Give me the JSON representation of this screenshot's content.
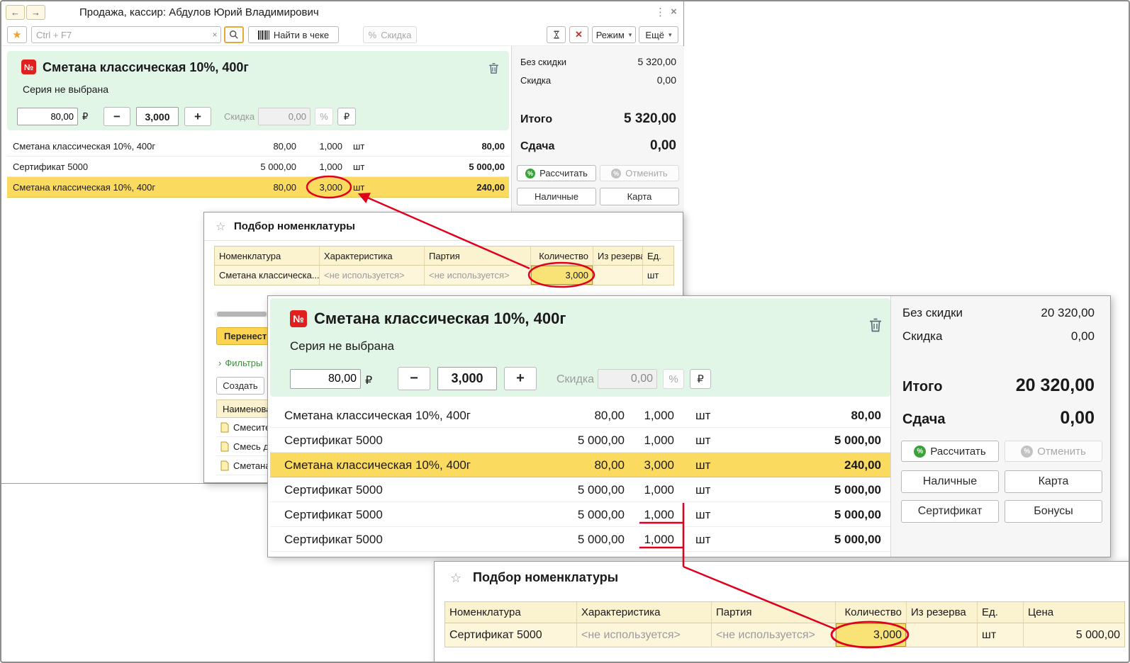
{
  "colors": {
    "accent_red": "#e0001e",
    "row_highlight": "#fbda60",
    "panel_green": "#e2f6e8",
    "header_yellow": "#fbf2d0"
  },
  "app": {
    "title": "Продажа, кассир: Абдулов Юрий Владимирович"
  },
  "icons": {
    "back": "←",
    "forward": "→",
    "menu": "⋮",
    "close": "×",
    "favorite": "★",
    "clear": "×",
    "cancel": "✕",
    "caret": "▾",
    "star_outline": "☆",
    "chevron": "›"
  },
  "sale1": {
    "toolbar": {
      "search_placeholder": "Ctrl + F7",
      "find_in_check": "Найти в чеке",
      "discount": "Скидка",
      "mode": "Режим",
      "more": "Ещё",
      "percent": "%"
    },
    "product": {
      "badge": "№",
      "name": "Сметана классическая 10%, 400г",
      "series": "Серия не выбрана",
      "price": "80,00",
      "currency": "₽",
      "minus": "−",
      "qty": "3,000",
      "plus": "+",
      "discount_label": "Скидка",
      "discount_value": "0,00",
      "percent": "%",
      "ruble": "₽"
    },
    "items": [
      {
        "name": "Сметана классическая 10%, 400г",
        "price": "80,00",
        "qty": "1,000",
        "unit": "шт",
        "sum": "80,00"
      },
      {
        "name": "Сертификат 5000",
        "price": "5 000,00",
        "qty": "1,000",
        "unit": "шт",
        "sum": "5 000,00"
      },
      {
        "name": "Сметана классическая 10%, 400г",
        "price": "80,00",
        "qty": "3,000",
        "unit": "шт",
        "sum": "240,00"
      }
    ],
    "totals": {
      "no_discount_label": "Без скидки",
      "no_discount": "5 320,00",
      "discount_label": "Скидка",
      "discount": "0,00",
      "total_label": "Итого",
      "total": "5 320,00",
      "change_label": "Сдача",
      "change": "0,00",
      "calculate": "Рассчитать",
      "cancel": "Отменить",
      "cash": "Наличные",
      "card": "Карта",
      "percent": "%"
    }
  },
  "picker1": {
    "title": "Подбор номенклатуры",
    "columns": {
      "nomenclature": "Номенклатура",
      "characteristic": "Характеристика",
      "batch": "Партия",
      "quantity": "Количество",
      "reserve": "Из резерва",
      "unit": "Ед."
    },
    "row": {
      "name": "Сметана классическа...",
      "characteristic": "<не используется>",
      "batch": "<не используется>",
      "qty": "3,000",
      "reserve": "",
      "unit": "шт"
    },
    "transfer": "Перенести",
    "filters": "Фильтры",
    "create": "Создать",
    "list_header": "Наименование",
    "list_items": [
      {
        "name": "Смесите"
      },
      {
        "name": "Смесь д"
      },
      {
        "name": "Сметана"
      }
    ]
  },
  "sale2": {
    "product": {
      "badge": "№",
      "name": "Сметана классическая 10%, 400г",
      "series": "Серия не выбрана",
      "price": "80,00",
      "currency": "₽",
      "minus": "−",
      "qty": "3,000",
      "plus": "+",
      "discount_label": "Скидка",
      "discount_value": "0,00",
      "percent": "%",
      "ruble": "₽"
    },
    "items": [
      {
        "name": "Сметана классическая 10%, 400г",
        "price": "80,00",
        "qty": "1,000",
        "unit": "шт",
        "sum": "80,00"
      },
      {
        "name": "Сертификат 5000",
        "price": "5 000,00",
        "qty": "1,000",
        "unit": "шт",
        "sum": "5 000,00"
      },
      {
        "name": "Сметана классическая 10%, 400г",
        "price": "80,00",
        "qty": "3,000",
        "unit": "шт",
        "sum": "240,00"
      },
      {
        "name": "Сертификат 5000",
        "price": "5 000,00",
        "qty": "1,000",
        "unit": "шт",
        "sum": "5 000,00"
      },
      {
        "name": "Сертификат 5000",
        "price": "5 000,00",
        "qty": "1,000",
        "unit": "шт",
        "sum": "5 000,00"
      },
      {
        "name": "Сертификат 5000",
        "price": "5 000,00",
        "qty": "1,000",
        "unit": "шт",
        "sum": "5 000,00"
      }
    ],
    "totals": {
      "no_discount_label": "Без скидки",
      "no_discount": "20 320,00",
      "discount_label": "Скидка",
      "discount": "0,00",
      "total_label": "Итого",
      "total": "20 320,00",
      "change_label": "Сдача",
      "change": "0,00",
      "calculate": "Рассчитать",
      "cancel": "Отменить",
      "cash": "Наличные",
      "card": "Карта",
      "certificate": "Сертификат",
      "bonuses": "Бонусы",
      "percent": "%"
    }
  },
  "picker2": {
    "title": "Подбор номенклатуры",
    "columns": {
      "nomenclature": "Номенклатура",
      "characteristic": "Характеристика",
      "batch": "Партия",
      "quantity": "Количество",
      "reserve": "Из резерва",
      "unit": "Ед.",
      "price": "Цена"
    },
    "row": {
      "name": "Сертификат 5000",
      "characteristic": "<не используется>",
      "batch": "<не используется>",
      "qty": "3,000",
      "reserve": "",
      "unit": "шт",
      "price": "5 000,00"
    }
  }
}
